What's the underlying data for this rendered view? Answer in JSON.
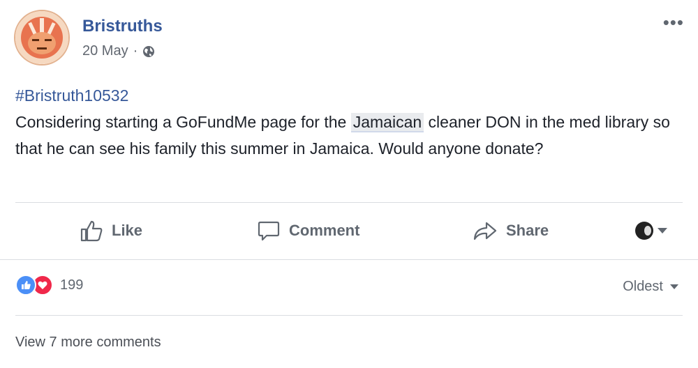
{
  "post": {
    "author": "Bristruths",
    "date": "20 May",
    "separator": "·",
    "hashtag": "#Bristruth10532",
    "body_before": "Considering starting a GoFundMe page for the ",
    "body_mention": "Jamaican",
    "body_after": " cleaner DON in the med library so that he can see his family this summer in Jamaica. Would anyone donate?"
  },
  "actions": {
    "like": "Like",
    "comment": "Comment",
    "share": "Share"
  },
  "reactions": {
    "count": "199"
  },
  "comments": {
    "sort_label": "Oldest",
    "view_more": "View 7 more comments"
  },
  "colors": {
    "link_blue": "#365899",
    "like_blue": "#4b8ff7",
    "love_red": "#f0284a",
    "muted": "#606770"
  },
  "icons": [
    "avatar-logo",
    "globe-icon",
    "more-options-icon",
    "thumbs-up-icon",
    "comment-icon",
    "share-icon",
    "chevron-down-icon",
    "like-reaction-icon",
    "love-reaction-icon"
  ]
}
